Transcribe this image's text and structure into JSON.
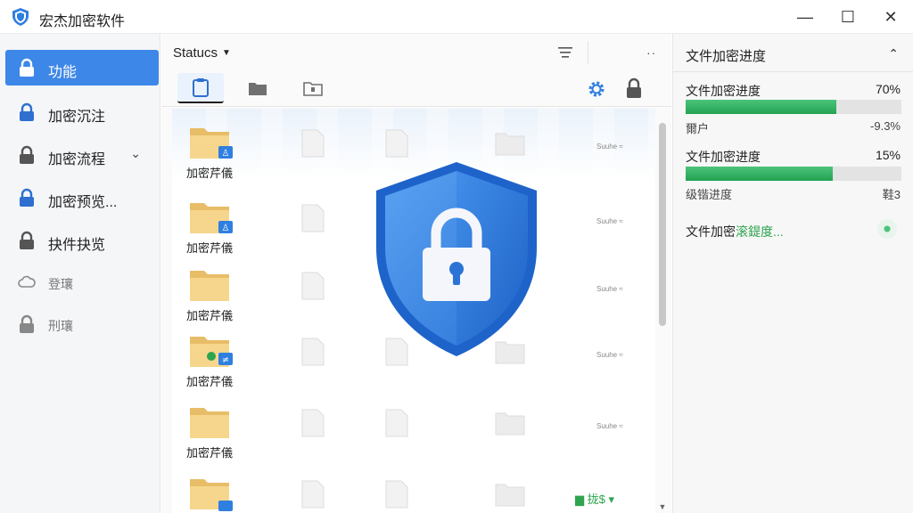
{
  "window": {
    "title": "宏杰加密软件",
    "controls": {
      "minimize": "—",
      "maximize": "☐",
      "close": "✕"
    }
  },
  "sidebar": {
    "items": [
      {
        "label": "功能",
        "icon": "lock-icon",
        "active": true
      },
      {
        "label": "加密沉注",
        "icon": "lock-icon"
      },
      {
        "label": "加密流程",
        "icon": "lock-icon",
        "expandable": true
      },
      {
        "label": "加密预览...",
        "icon": "lock-icon"
      },
      {
        "label": "抉件抉览",
        "icon": "lock-icon"
      },
      {
        "label": "登瓖",
        "icon": "cloud-icon",
        "muted": true
      },
      {
        "label": "刑瓖",
        "icon": "lock-icon",
        "muted": true
      }
    ],
    "chevron": "⌄"
  },
  "toolbar": {
    "status_label": "Statucs",
    "status_caret": "▼",
    "more": "··"
  },
  "files": {
    "rows": [
      {
        "label": "加密芹儀",
        "status": "Suuhe ≈"
      },
      {
        "label": "加密芹儀",
        "status": "Suuhe ≈"
      },
      {
        "label": "加密芹儀",
        "status": "Suuhe ≈"
      },
      {
        "label": "加密芹儀",
        "status": "Suuhe ≈"
      },
      {
        "label": "加密芹儀",
        "status": "Suuhe ≈"
      },
      {
        "label": "",
        "status_green": "▆ 拢$ ▾"
      }
    ]
  },
  "panel": {
    "title": "文件加密进度",
    "collapse": "⌃",
    "progress": [
      {
        "label": "文件加密进度",
        "percent_text": "70%",
        "value": 0.7,
        "sub_label": "爾户",
        "sub_value": "-9.3%"
      },
      {
        "label": "文件加密进度",
        "percent_text": "15%",
        "value": 0.68,
        "sub_label": "级锴进度",
        "sub_value": "鞋3"
      }
    ],
    "speed_prefix": "文件加密",
    "speed_green": "滚鍉度...",
    "accent_green": "#2ea44f"
  },
  "colors": {
    "accent_blue": "#3d87e8",
    "sidebar_bg": "#f5f6f8",
    "shield_blue": "#2f7fe0"
  }
}
